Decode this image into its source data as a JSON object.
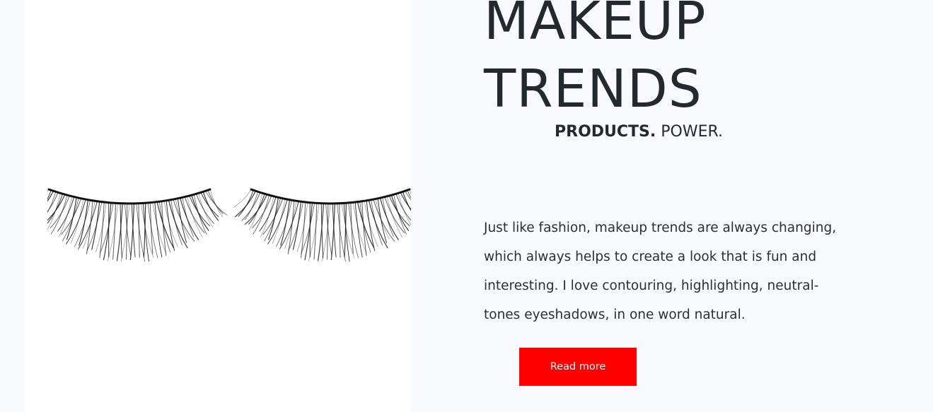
{
  "hero": {
    "image_icon": "eyelashes-illustration",
    "heading_line1": "MAKEUP",
    "heading_line2": "TRENDS",
    "tagline_strong": "PRODUCTS.",
    "tagline_light": " POWER.",
    "description": "Just like fashion, makeup trends are always changing, which always helps to create a look that is fun and interesting. I love contouring, highlighting, neutral-tones eyeshadows, in one word natural.",
    "read_more_label": "Read more"
  },
  "colors": {
    "page_background": "#f9fafd",
    "image_panel_background": "#ffffff",
    "heading_text": "#232a2e",
    "button_background": "#ff0000",
    "button_text": "#ffffff"
  }
}
